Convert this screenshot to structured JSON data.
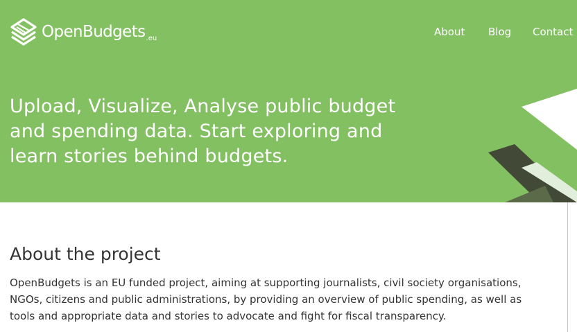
{
  "header": {
    "logo": {
      "name": "OpenBudgets",
      "suffix": ".eu"
    },
    "nav": [
      {
        "label": "About"
      },
      {
        "label": "Blog"
      },
      {
        "label": "Contact"
      }
    ]
  },
  "hero": {
    "title": "Upload, Visualize, Analyse public budget and spending data. Start exploring and learn stories behind budgets."
  },
  "about": {
    "heading": "About the project",
    "body": "OpenBudgets is an EU funded project, aiming at supporting journalists, civil society organisations, NGOs, citizens and public administrations, by providing an overview of public spending, as well as tools and appropriate data and stories to advocate and fight for fiscal transparency."
  },
  "colors": {
    "brand_green": "#83c062",
    "text": "#333333",
    "decor_dark": "#424a37"
  }
}
